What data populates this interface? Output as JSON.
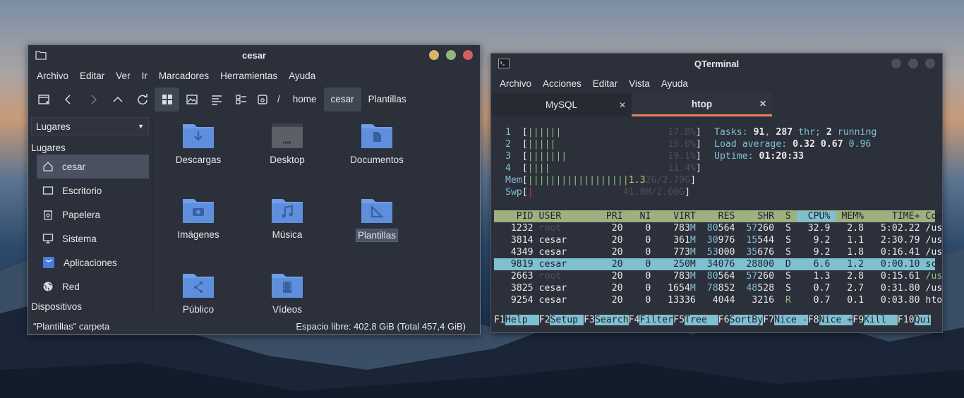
{
  "fm": {
    "title": "cesar",
    "menu": [
      "Archivo",
      "Editar",
      "Ver",
      "Ir",
      "Marcadores",
      "Herramientas",
      "Ayuda"
    ],
    "breadcrumb": [
      "/",
      "home",
      "cesar",
      "Plantillas"
    ],
    "sidebar": {
      "combo": "Lugares",
      "section_places": "Lugares",
      "items": [
        "cesar",
        "Escritorio",
        "Papelera",
        "Sistema",
        "Aplicaciones",
        "Red"
      ],
      "section_devices": "Dispositivos"
    },
    "files": [
      "Descargas",
      "Desktop",
      "Documentos",
      "Imágenes",
      "Música",
      "Plantillas",
      "Público",
      "Vídeos"
    ],
    "status_left": "\"Plantillas\" carpeta",
    "status_right": "Espacio libre: 402,8 GiB (Total 457,4 GiB)"
  },
  "term": {
    "title": "QTerminal",
    "menu": [
      "Archivo",
      "Acciones",
      "Editar",
      "Vista",
      "Ayuda"
    ],
    "tabs": [
      "MySQL",
      "htop"
    ],
    "cpus": [
      {
        "n": "1",
        "bars": "||||||",
        "pct": "17.8%"
      },
      {
        "n": "2",
        "bars": "|||||",
        "pct": "15.0%"
      },
      {
        "n": "3",
        "bars": "|||||||",
        "pct": "19.1%"
      },
      {
        "n": "4",
        "bars": "||||",
        "pct": "11.4%"
      }
    ],
    "mem": {
      "label": "Mem",
      "bars": "||||||||||||||||||",
      "used": "1.3",
      "rest": "2G/2.79G"
    },
    "swp": {
      "label": "Swp",
      "bars": "|",
      "val": "41.0M/2.00G"
    },
    "tasks_label": "Tasks:",
    "tasks": "91",
    "thr": "287",
    "thr_label": "thr;",
    "running": "2",
    "running_label": "running",
    "load_label": "Load average:",
    "load": [
      "0.32",
      "0.67",
      "0.96"
    ],
    "uptime_label": "Uptime:",
    "uptime": "01:20:33",
    "header": [
      "PID",
      "USER",
      "PRI",
      "NI",
      "VIRT",
      "RES",
      "SHR",
      "S",
      "CPU%",
      "MEM%",
      "TIME+",
      "Command"
    ],
    "procs": [
      [
        "1232",
        "root",
        "20",
        "0",
        "783M",
        "80564",
        "57260",
        "S",
        "32.9",
        "2.8",
        "5:02.22",
        "/usr/lib/xorg"
      ],
      [
        "3814",
        "cesar",
        "20",
        "0",
        "361M",
        "30976",
        "15544",
        "S",
        "9.2",
        "1.1",
        "2:30.79",
        "/usr/bin/comp"
      ],
      [
        "4349",
        "cesar",
        "20",
        "0",
        "773M",
        "53000",
        "35676",
        "S",
        "9.2",
        "1.8",
        "0:16.41",
        "/usr/bin/plan"
      ],
      [
        "9819",
        "cesar",
        "20",
        "0",
        "250M",
        "34076",
        "28800",
        "D",
        "6.6",
        "1.2",
        "0:00.10",
        "screengrab"
      ],
      [
        "2663",
        "root",
        "20",
        "0",
        "783M",
        "80564",
        "57260",
        "S",
        "1.3",
        "2.8",
        "0:15.61",
        "/usr/lib/xorg"
      ],
      [
        "3825",
        "cesar",
        "20",
        "0",
        "1654M",
        "78852",
        "48528",
        "S",
        "0.7",
        "2.7",
        "0:31.80",
        "/usr/bin/pcma"
      ],
      [
        "9254",
        "cesar",
        "20",
        "0",
        "13336",
        "4044",
        "3216",
        "R",
        "0.7",
        "0.1",
        "0:03.80",
        "htop"
      ]
    ],
    "fkeys": [
      [
        "F1",
        "Help  "
      ],
      [
        "F2",
        "Setup "
      ],
      [
        "F3",
        "Search"
      ],
      [
        "F4",
        "Filter"
      ],
      [
        "F5",
        "Tree  "
      ],
      [
        "F6",
        "SortBy"
      ],
      [
        "F7",
        "Nice -"
      ],
      [
        "F8",
        "Nice +"
      ],
      [
        "F9",
        "Kill  "
      ],
      [
        "F10",
        "Qui"
      ]
    ]
  }
}
